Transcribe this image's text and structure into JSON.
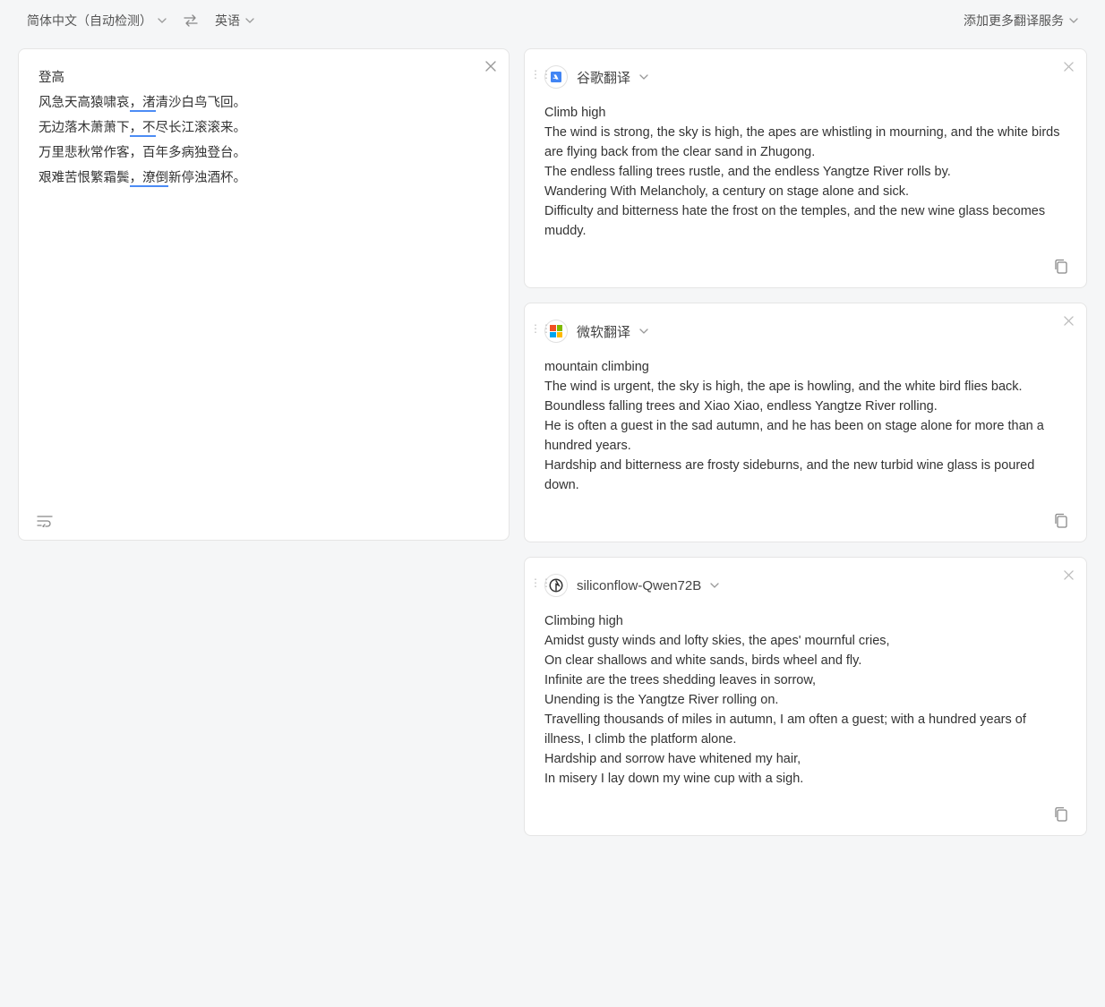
{
  "header": {
    "source_lang": "简体中文（自动检测）",
    "target_lang": "英语",
    "add_services": "添加更多翻译服务"
  },
  "input": {
    "lines": [
      {
        "prefix": "登高",
        "err": "",
        "suffix": ""
      },
      {
        "prefix": "风急天高猿啸哀",
        "err": "，渚",
        "suffix": "清沙白鸟飞回。"
      },
      {
        "prefix": "无边落木萧萧下",
        "err": "，不",
        "suffix": "尽长江滚滚来。"
      },
      {
        "prefix": "万里悲秋常作客，百年多病独登台。",
        "err": "",
        "suffix": ""
      },
      {
        "prefix": "艰难苦恨繁霜鬓",
        "err": "，潦倒",
        "suffix": "新停浊酒杯。"
      }
    ]
  },
  "translations": [
    {
      "service": "谷歌翻译",
      "icon": "google",
      "text": "Climb high\nThe wind is strong, the sky is high, the apes are whistling in mourning, and the white birds are flying back from the clear sand in Zhugong.\nThe endless falling trees rustle, and the endless Yangtze River rolls by.\nWandering With Melancholy, a century on stage alone and sick.\nDifficulty and bitterness hate the frost on the temples, and the new wine glass becomes muddy."
    },
    {
      "service": "微软翻译",
      "icon": "microsoft",
      "text": "mountain climbing\nThe wind is urgent, the sky is high, the ape is howling, and the white bird flies back.\nBoundless falling trees and Xiao Xiao, endless Yangtze River rolling.\nHe is often a guest in the sad autumn, and he has been on stage alone for more than a hundred years.\nHardship and bitterness are frosty sideburns, and the new turbid wine glass is poured down."
    },
    {
      "service": "siliconflow-Qwen72B",
      "icon": "siliconflow",
      "text": "Climbing high\nAmidst gusty winds and lofty skies, the apes' mournful cries,\nOn clear shallows and white sands, birds wheel and fly.\nInfinite are the trees shedding leaves in sorrow,\nUnending is the Yangtze River rolling on.\nTravelling thousands of miles in autumn, I am often a guest; with a hundred years of illness, I climb the platform alone.\nHardship and sorrow have whitened my hair,\nIn misery I lay down my wine cup with a sigh."
    }
  ]
}
